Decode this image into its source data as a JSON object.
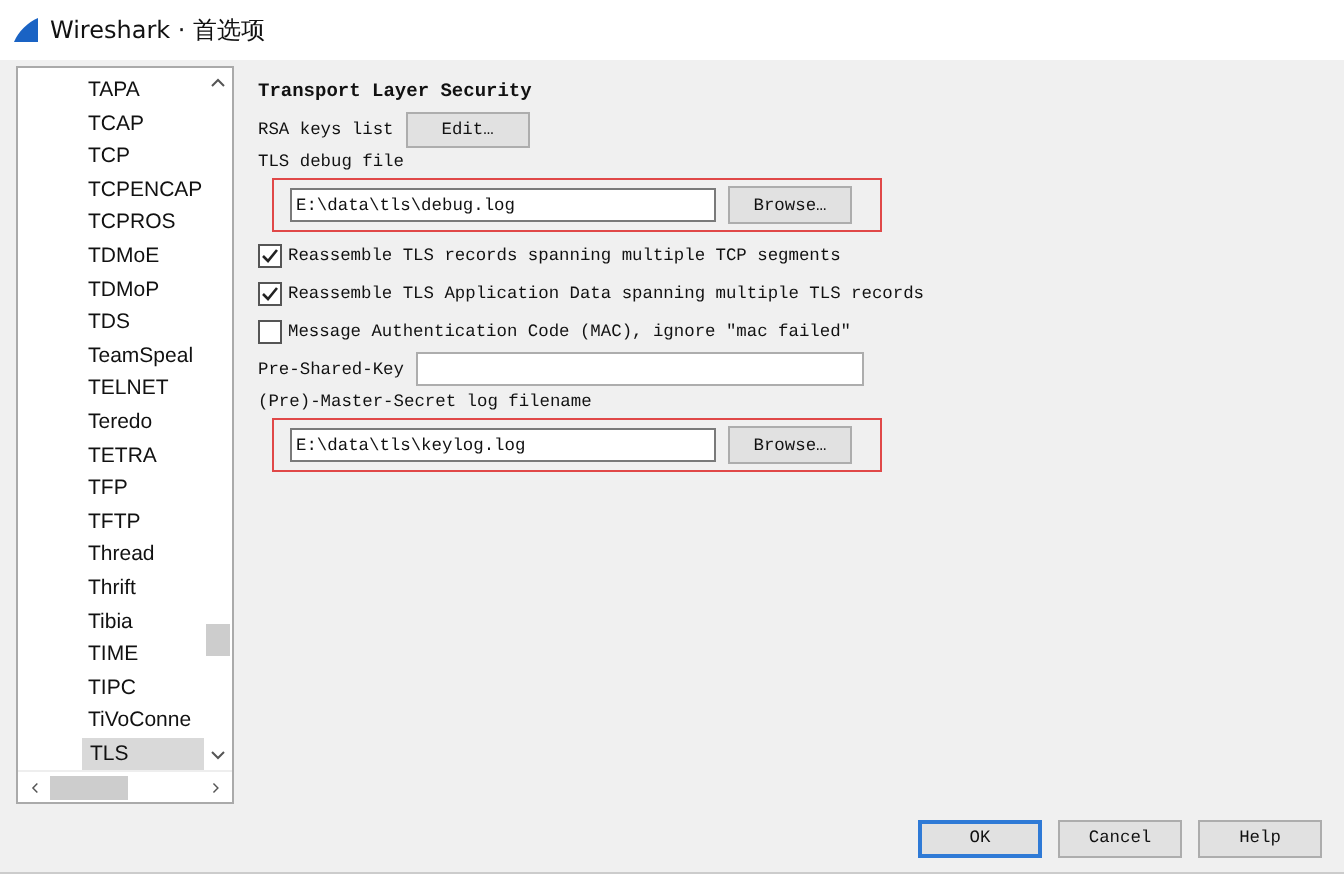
{
  "window": {
    "title": "Wireshark · 首选项"
  },
  "protocol_list": {
    "items": [
      {
        "label": "TAPA",
        "selected": false
      },
      {
        "label": "TCAP",
        "selected": false
      },
      {
        "label": "TCP",
        "selected": false
      },
      {
        "label": "TCPENCAP",
        "selected": false
      },
      {
        "label": "TCPROS",
        "selected": false
      },
      {
        "label": "TDMoE",
        "selected": false
      },
      {
        "label": "TDMoP",
        "selected": false
      },
      {
        "label": "TDS",
        "selected": false
      },
      {
        "label": "TeamSpeal",
        "selected": false
      },
      {
        "label": "TELNET",
        "selected": false
      },
      {
        "label": "Teredo",
        "selected": false
      },
      {
        "label": "TETRA",
        "selected": false
      },
      {
        "label": "TFP",
        "selected": false
      },
      {
        "label": "TFTP",
        "selected": false
      },
      {
        "label": "Thread",
        "selected": false
      },
      {
        "label": "Thrift",
        "selected": false
      },
      {
        "label": "Tibia",
        "selected": false
      },
      {
        "label": "TIME",
        "selected": false
      },
      {
        "label": "TIPC",
        "selected": false
      },
      {
        "label": "TiVoConne",
        "selected": false
      },
      {
        "label": "TLS",
        "selected": true
      }
    ]
  },
  "panel": {
    "title": "Transport Layer Security",
    "rows": [
      {
        "kind": "button",
        "label": "RSA keys list",
        "button": "Edit…"
      },
      {
        "kind": "caption",
        "label": "TLS debug file"
      },
      {
        "kind": "file",
        "value": "E:\\data\\tls\\debug.log",
        "button": "Browse…",
        "highlighted": true
      },
      {
        "kind": "checkbox",
        "label": "Reassemble TLS records spanning multiple TCP segments",
        "checked": true
      },
      {
        "kind": "checkbox",
        "label": "Reassemble TLS Application Data spanning multiple TLS records",
        "checked": true
      },
      {
        "kind": "checkbox",
        "label": "Message Authentication Code (MAC), ignore \"mac failed\"",
        "checked": false
      },
      {
        "kind": "text",
        "label": "Pre-Shared-Key"
      },
      {
        "kind": "caption",
        "label": "(Pre)-Master-Secret log filename"
      },
      {
        "kind": "file",
        "value": "E:\\data\\tls\\keylog.log",
        "button": "Browse…",
        "highlighted": true
      }
    ]
  },
  "buttons": [
    {
      "label": "OK",
      "default": true
    },
    {
      "label": "Cancel",
      "default": false
    },
    {
      "label": "Help",
      "default": false
    }
  ]
}
